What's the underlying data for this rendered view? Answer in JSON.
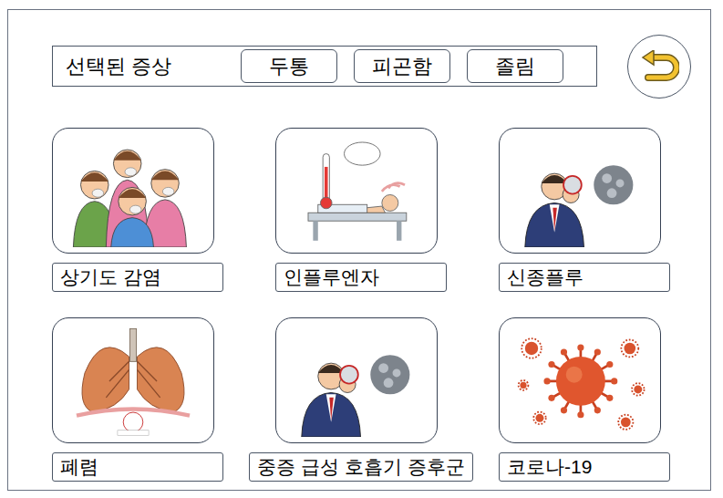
{
  "header": {
    "title": "선택된 증상",
    "symptoms": [
      "두통",
      "피곤함",
      "졸림"
    ]
  },
  "diseases": [
    {
      "name": "상기도 감염",
      "kind": "people"
    },
    {
      "name": "인플루엔자",
      "kind": "fever"
    },
    {
      "name": "신종플루",
      "kind": "virusman"
    },
    {
      "name": "폐렴",
      "kind": "lungs"
    },
    {
      "name": "중증 급성 호흡기 증후군",
      "kind": "virusman"
    },
    {
      "name": "코로나-19",
      "kind": "corona"
    }
  ]
}
